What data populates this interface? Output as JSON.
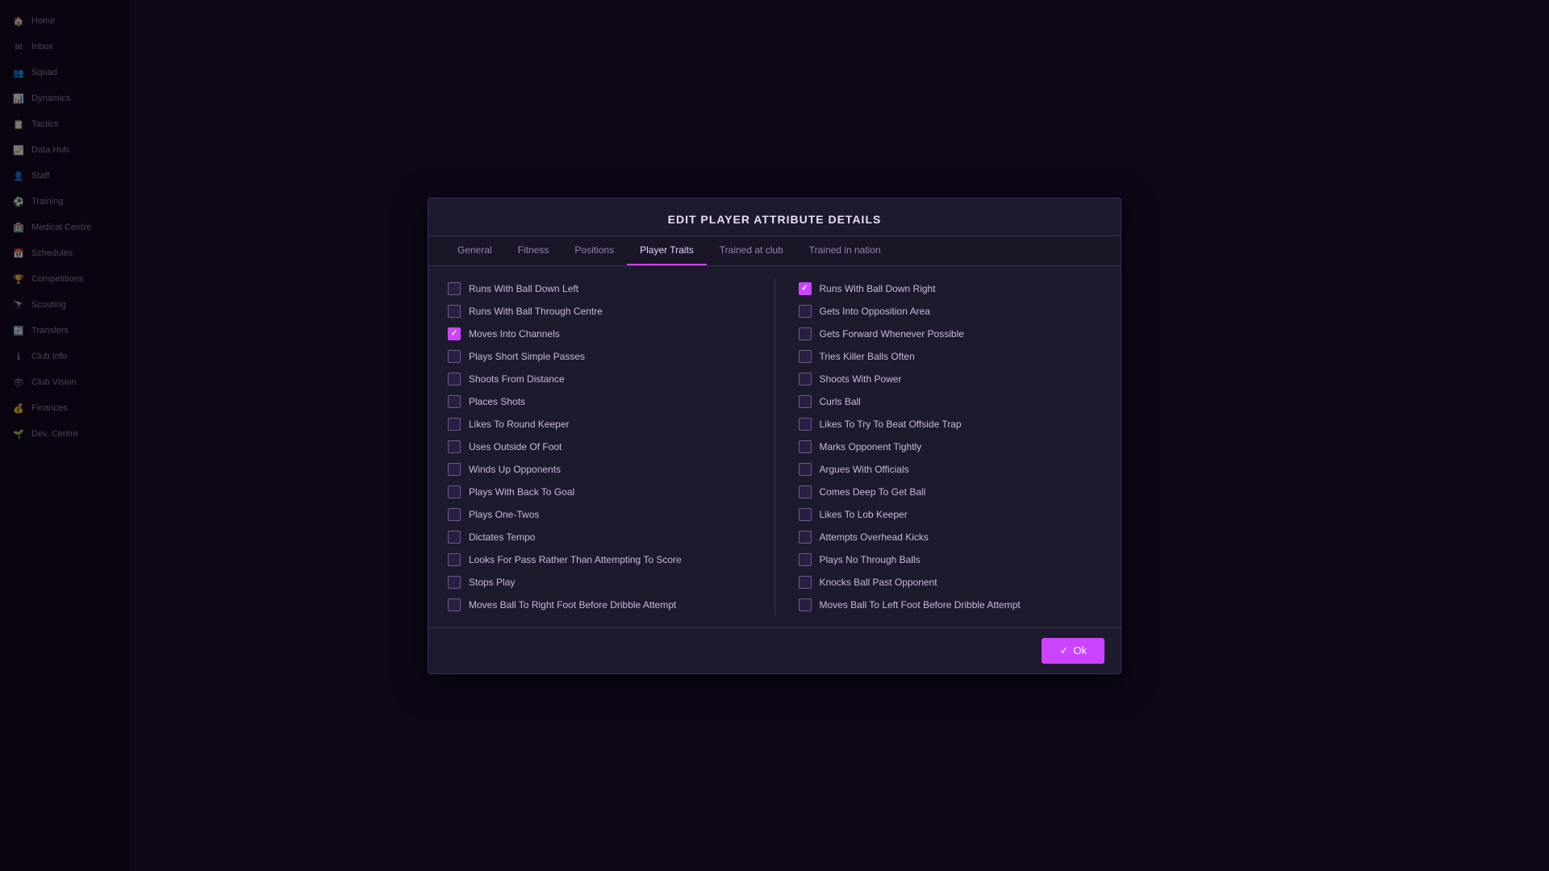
{
  "modal": {
    "title": "EDIT PLAYER ATTRIBUTE DETAILS",
    "tabs": [
      {
        "id": "general",
        "label": "General",
        "active": false
      },
      {
        "id": "fitness",
        "label": "Fitness",
        "active": false
      },
      {
        "id": "positions",
        "label": "Positions",
        "active": false
      },
      {
        "id": "player-traits",
        "label": "Player Traits",
        "active": true
      },
      {
        "id": "trained-at-club",
        "label": "Trained at club",
        "active": false
      },
      {
        "id": "trained-in-nation",
        "label": "Trained in nation",
        "active": false
      }
    ],
    "ok_button": "Ok",
    "left_traits": [
      {
        "id": "runs-ball-down-left",
        "label": "Runs With Ball Down Left",
        "checked": false
      },
      {
        "id": "runs-ball-through-centre",
        "label": "Runs With Ball Through Centre",
        "checked": false
      },
      {
        "id": "moves-into-channels",
        "label": "Moves Into Channels",
        "checked": true
      },
      {
        "id": "plays-short-simple-passes",
        "label": "Plays Short Simple Passes",
        "checked": false
      },
      {
        "id": "shoots-from-distance",
        "label": "Shoots From Distance",
        "checked": false
      },
      {
        "id": "places-shots",
        "label": "Places Shots",
        "checked": false
      },
      {
        "id": "likes-to-round-keeper",
        "label": "Likes To Round Keeper",
        "checked": false
      },
      {
        "id": "uses-outside-of-foot",
        "label": "Uses Outside Of Foot",
        "checked": false
      },
      {
        "id": "winds-up-opponents",
        "label": "Winds Up Opponents",
        "checked": false
      },
      {
        "id": "plays-with-back-to-goal",
        "label": "Plays With Back To Goal",
        "checked": false
      },
      {
        "id": "plays-one-twos",
        "label": "Plays One-Twos",
        "checked": false
      },
      {
        "id": "dictates-tempo",
        "label": "Dictates Tempo",
        "checked": false
      },
      {
        "id": "looks-for-pass-rather-than-score",
        "label": "Looks For Pass Rather Than Attempting To Score",
        "checked": false
      },
      {
        "id": "stops-play",
        "label": "Stops Play",
        "checked": false
      },
      {
        "id": "moves-ball-to-right-foot",
        "label": "Moves Ball To Right Foot Before Dribble Attempt",
        "checked": false
      }
    ],
    "right_traits": [
      {
        "id": "runs-ball-down-right",
        "label": "Runs With Ball Down Right",
        "checked": true
      },
      {
        "id": "gets-into-opposition-area",
        "label": "Gets Into Opposition Area",
        "checked": false
      },
      {
        "id": "gets-forward-whenever-possible",
        "label": "Gets Forward Whenever Possible",
        "checked": false
      },
      {
        "id": "tries-killer-balls-often",
        "label": "Tries Killer Balls Often",
        "checked": false
      },
      {
        "id": "shoots-with-power",
        "label": "Shoots With Power",
        "checked": false
      },
      {
        "id": "curls-ball",
        "label": "Curls Ball",
        "checked": false
      },
      {
        "id": "likes-to-beat-offside-trap",
        "label": "Likes To Try To Beat Offside Trap",
        "checked": false
      },
      {
        "id": "marks-opponent-tightly",
        "label": "Marks Opponent Tightly",
        "checked": false
      },
      {
        "id": "argues-with-officials",
        "label": "Argues With Officials",
        "checked": false
      },
      {
        "id": "comes-deep-to-get-ball",
        "label": "Comes Deep To Get Ball",
        "checked": false
      },
      {
        "id": "likes-to-lob-keeper",
        "label": "Likes To Lob Keeper",
        "checked": false
      },
      {
        "id": "attempts-overhead-kicks",
        "label": "Attempts Overhead Kicks",
        "checked": false
      },
      {
        "id": "plays-no-through-balls",
        "label": "Plays No Through Balls",
        "checked": false
      },
      {
        "id": "knocks-ball-past-opponent",
        "label": "Knocks Ball Past Opponent",
        "checked": false
      },
      {
        "id": "moves-ball-to-left-foot",
        "label": "Moves Ball To Left Foot Before Dribble Attempt",
        "checked": false
      }
    ]
  },
  "sidebar": {
    "items": [
      {
        "id": "home",
        "label": "Home",
        "icon": "🏠"
      },
      {
        "id": "inbox",
        "label": "Inbox",
        "icon": "✉"
      },
      {
        "id": "squad",
        "label": "Squad",
        "icon": "👥"
      },
      {
        "id": "dynamics",
        "label": "Dynamics",
        "icon": "📊"
      },
      {
        "id": "tactics",
        "label": "Tactics",
        "icon": "📋"
      },
      {
        "id": "data-hub",
        "label": "Data Hub",
        "icon": "📈"
      },
      {
        "id": "staff",
        "label": "Staff",
        "icon": "👤"
      },
      {
        "id": "training",
        "label": "Training",
        "icon": "⚽"
      },
      {
        "id": "medical-centre",
        "label": "Medical Centre",
        "icon": "🏥"
      },
      {
        "id": "schedules",
        "label": "Schedules",
        "icon": "📅"
      },
      {
        "id": "competitions",
        "label": "Competitions",
        "icon": "🏆"
      },
      {
        "id": "scouting",
        "label": "Scouting",
        "icon": "🔭"
      },
      {
        "id": "transfers",
        "label": "Transfers",
        "icon": "🔄"
      },
      {
        "id": "club-info",
        "label": "Club Info",
        "icon": "ℹ"
      },
      {
        "id": "club-vision",
        "label": "Club Vision",
        "icon": "👁"
      },
      {
        "id": "finances",
        "label": "Finances",
        "icon": "💰"
      },
      {
        "id": "dev-centre",
        "label": "Dev. Centre",
        "icon": "🌱"
      }
    ]
  }
}
